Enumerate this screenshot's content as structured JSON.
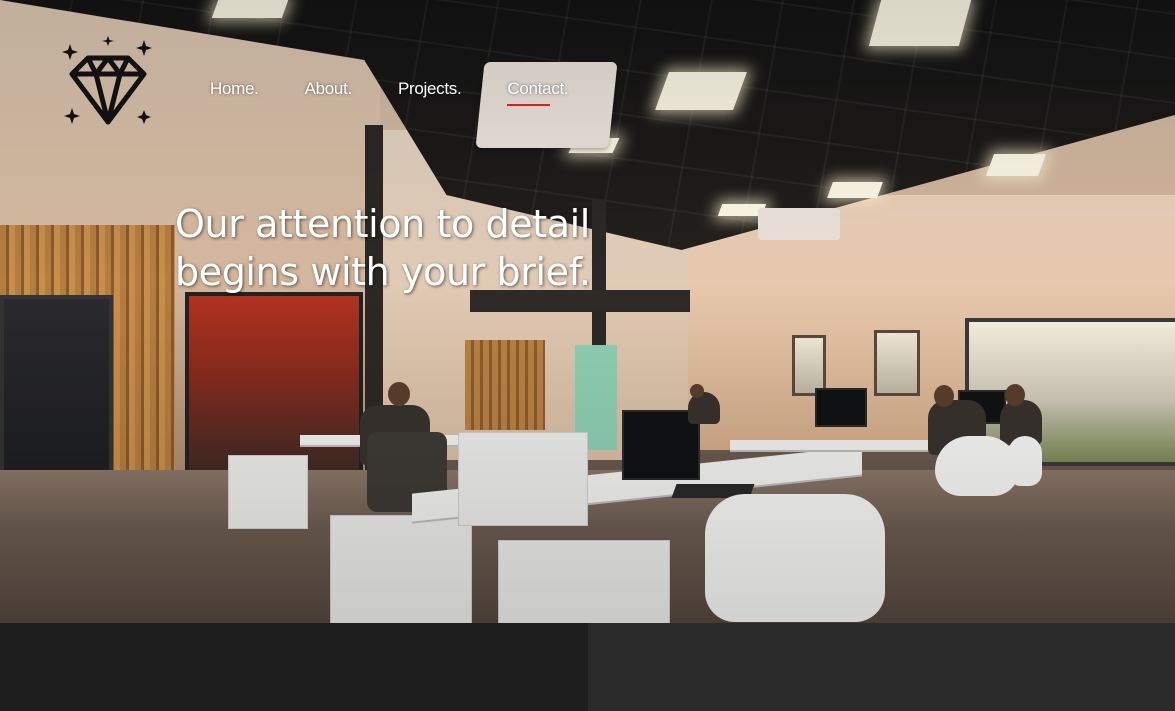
{
  "nav": {
    "items": [
      {
        "label": "Home.",
        "active": false
      },
      {
        "label": "About.",
        "active": false
      },
      {
        "label": "Projects.",
        "active": false
      },
      {
        "label": "Contact.",
        "active": true
      }
    ]
  },
  "hero": {
    "headline_line1": "Our attention to detail",
    "headline_line2": "begins with your brief."
  },
  "logo": {
    "icon": "diamond-icon"
  },
  "colors": {
    "nav_text": "#ffffff",
    "active_underline": "#d92020",
    "band_left": "#1e1e1e",
    "band_right": "#2b2b2b"
  }
}
